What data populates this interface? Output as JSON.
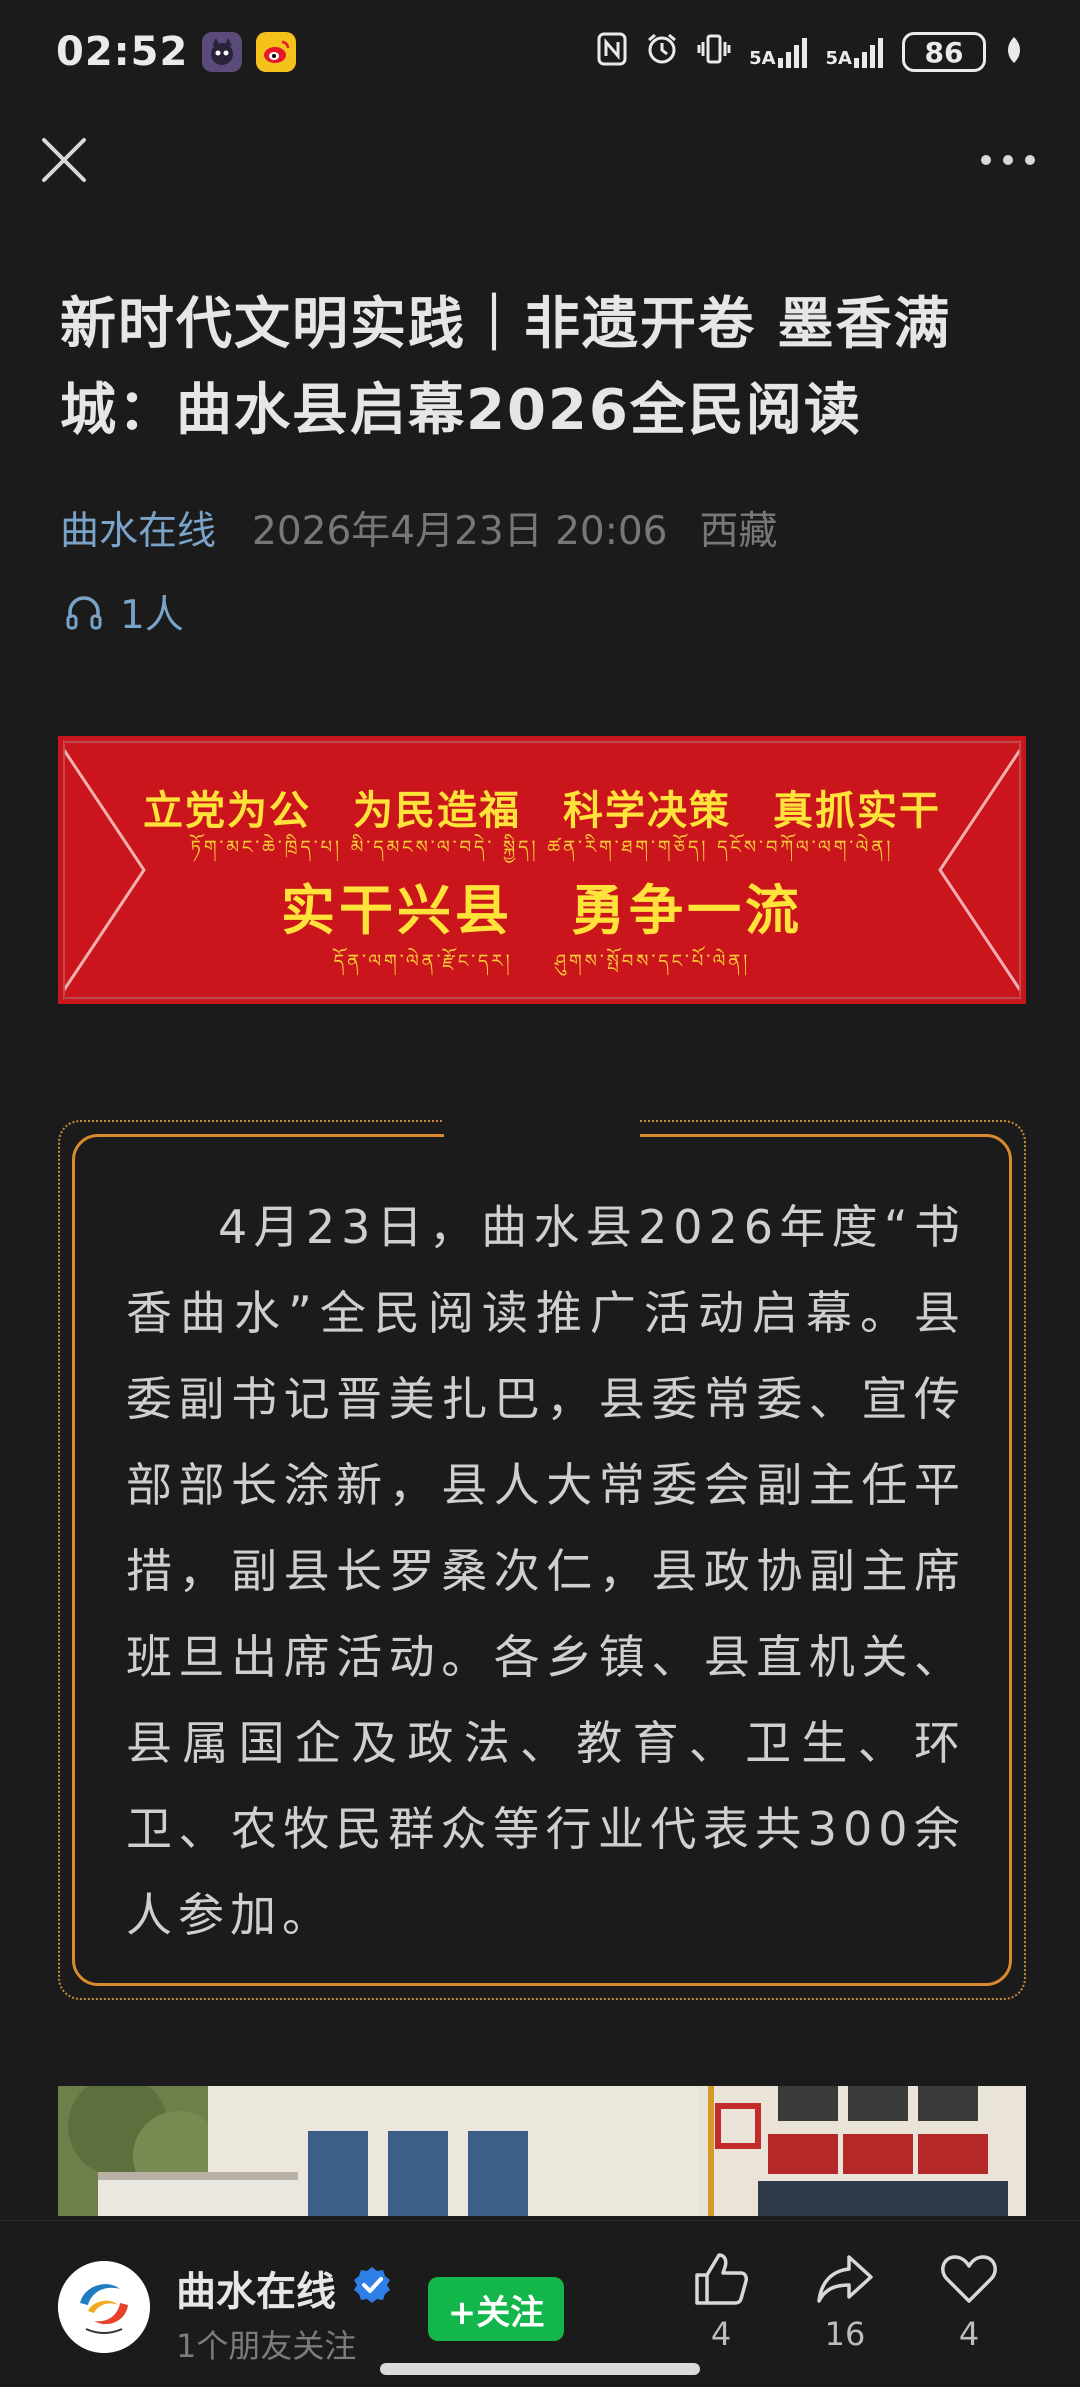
{
  "status_bar": {
    "time": "02:52",
    "battery": "86",
    "icons": [
      "nfc-icon",
      "alarm-icon",
      "vibrate-icon",
      "signal-5a-icon",
      "signal-5a-icon",
      "leaf-icon"
    ],
    "sim1_label": "5A",
    "sim2_label": "5A"
  },
  "article": {
    "title": "新时代文明实践｜非遗开卷 墨香满城：曲水县启幕2026全民阅读",
    "author": "曲水在线",
    "date": "2026年4月23日 20:06",
    "region": "西藏",
    "listeners": "1人"
  },
  "banner": {
    "line1": "立党为公　为民造福　科学决策　真抓实干",
    "line1_tibetan": "ཏོག་མང་ཆེ་ཁྲིད་པ། མི་དམངས་ལ་བདེ་ སྐྱིད། ཚན་རིག་ཐག་གཅོད། དངོས་བཀོལ་ལག་ལེན།",
    "line2": "实干兴县　勇争一流",
    "line2_tibetan": "དོན་ལག་ལེན་རྫོང་དར།　　ཤུགས་སྤོབས་དང་པོ་ལེན།"
  },
  "body": {
    "paragraph": "4月23日，曲水县2026年度“书香曲水”全民阅读推广活动启幕。县委副书记晋美扎巴，县委常委、宣传部部长涂新，县人大常委会副主任平措，副县长罗桑次仁，县政协副主席班旦出席活动。各乡镇、县直机关、县属国企及政法、教育、卫生、环卫、农牧民群众等行业代表共300余人参加。"
  },
  "bottom_bar": {
    "account_name": "曲水在线",
    "account_sub": "1个朋友关注",
    "follow_label": "+关注",
    "like_count": "4",
    "share_count": "16",
    "favorite_count": "4"
  },
  "colors": {
    "background": "#1b1b1b",
    "author_blue": "#7aa3c9",
    "banner_red": "#c9151b",
    "banner_text": "#ffe23a",
    "card_border": "#d98b2d",
    "follow_green": "#12b64a"
  }
}
